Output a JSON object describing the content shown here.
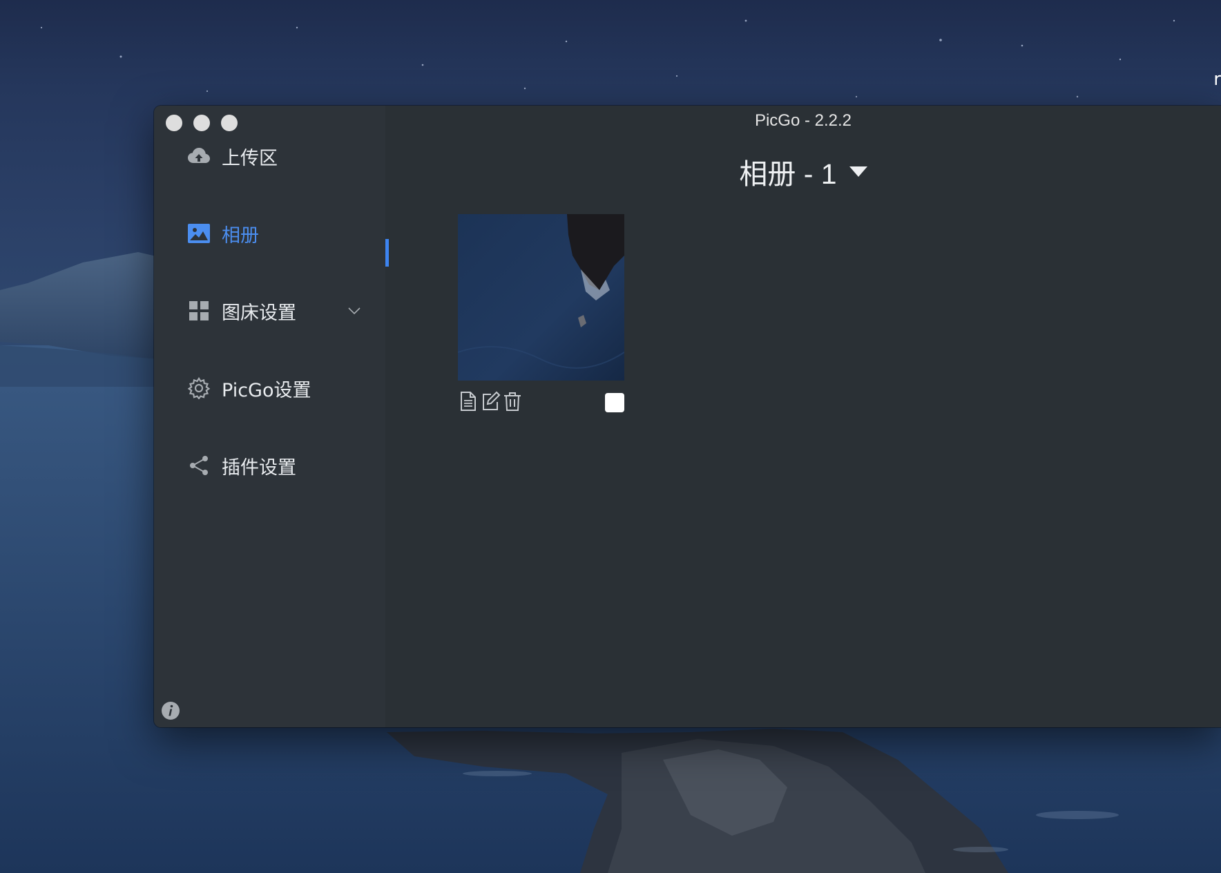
{
  "app": {
    "title": "PicGo - 2.2.2"
  },
  "desktop": {
    "edge_glyph": "r"
  },
  "sidebar": {
    "items": [
      {
        "label": "上传区",
        "icon": "cloud-upload-icon"
      },
      {
        "label": "相册",
        "icon": "picture-icon",
        "active": true
      },
      {
        "label": "图床设置",
        "icon": "grid-icon",
        "expandable": true
      },
      {
        "label": "PicGo设置",
        "icon": "gear-icon"
      },
      {
        "label": "插件设置",
        "icon": "share-icon"
      }
    ],
    "info_icon": "info-icon"
  },
  "gallery": {
    "header": "相册 - 1",
    "images": [
      {
        "actions": [
          "copy-document-icon",
          "edit-icon",
          "delete-icon"
        ],
        "selected": false
      }
    ]
  },
  "colors": {
    "accent": "#3d84f0",
    "active_text": "#4b8ef0",
    "window_bg": "#2a3035",
    "sidebar_bg": "#2d3339"
  }
}
